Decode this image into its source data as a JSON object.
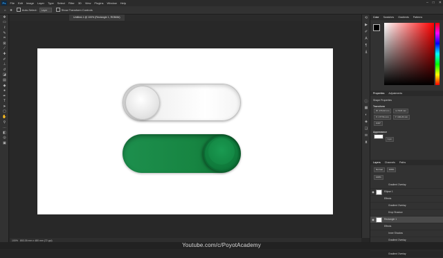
{
  "menubar": {
    "logo": "Ps",
    "items": [
      "File",
      "Edit",
      "Image",
      "Layer",
      "Type",
      "Select",
      "Filter",
      "3D",
      "View",
      "Plugins",
      "Window",
      "Help"
    ],
    "window_controls": [
      "–",
      "□",
      "✕"
    ]
  },
  "options": {
    "auto_select": "Auto-Select:",
    "auto_select_value": "Layer",
    "show_transform": "Show Transform Controls"
  },
  "document_tab": {
    "label": "Untitled-1 @ 100% (Rectangle 1, RGB/8#)"
  },
  "statusbar": {
    "zoom": "100%",
    "doc_info": "853.35 mm x 480 mm (72 ppi)"
  },
  "watermark": "Youtube.com/c/PoyotAcademy",
  "colors": {
    "toggle_on": "#178542",
    "toggle_off": "#f4f4f4",
    "canvas": "#ffffff",
    "workspace": "#282828"
  },
  "panels": {
    "color_tabs": [
      "Color",
      "Swatches",
      "Gradients",
      "Patterns"
    ],
    "properties_tabs": [
      "Properties",
      "Adjustments"
    ],
    "properties_type": "Shape Properties",
    "transform_label": "Transform",
    "appearance_label": "Appearance",
    "fields": {
      "w": "W: 170.22 mm",
      "h": "H: 53.8 mm",
      "x": "X: 177.51 mm",
      "y": "Y: 194.23 mm",
      "angle": "0.00°",
      "stroke": "1 px"
    },
    "layers_tabs": [
      "Layers",
      "Channels",
      "Paths"
    ],
    "blend_mode": "Normal",
    "opacity": "100%",
    "fill": "100%",
    "layers": [
      {
        "name": "Gradient Overlay",
        "kind": "effect-sub"
      },
      {
        "name": "Ellipse 1",
        "kind": "layer"
      },
      {
        "name": "Effects",
        "kind": "effect"
      },
      {
        "name": "Gradient Overlay",
        "kind": "effect-sub"
      },
      {
        "name": "Drop Shadow",
        "kind": "effect-sub"
      },
      {
        "name": "Rectangle 1",
        "kind": "layer-selected"
      },
      {
        "name": "Effects",
        "kind": "effect"
      },
      {
        "name": "Inner Shadow",
        "kind": "effect-sub"
      },
      {
        "name": "Gradient Overlay",
        "kind": "effect-sub"
      },
      {
        "name": "Drop Shadow",
        "kind": "effect-sub"
      },
      {
        "name": "Gradient Overlay",
        "kind": "effect-sub"
      }
    ]
  }
}
